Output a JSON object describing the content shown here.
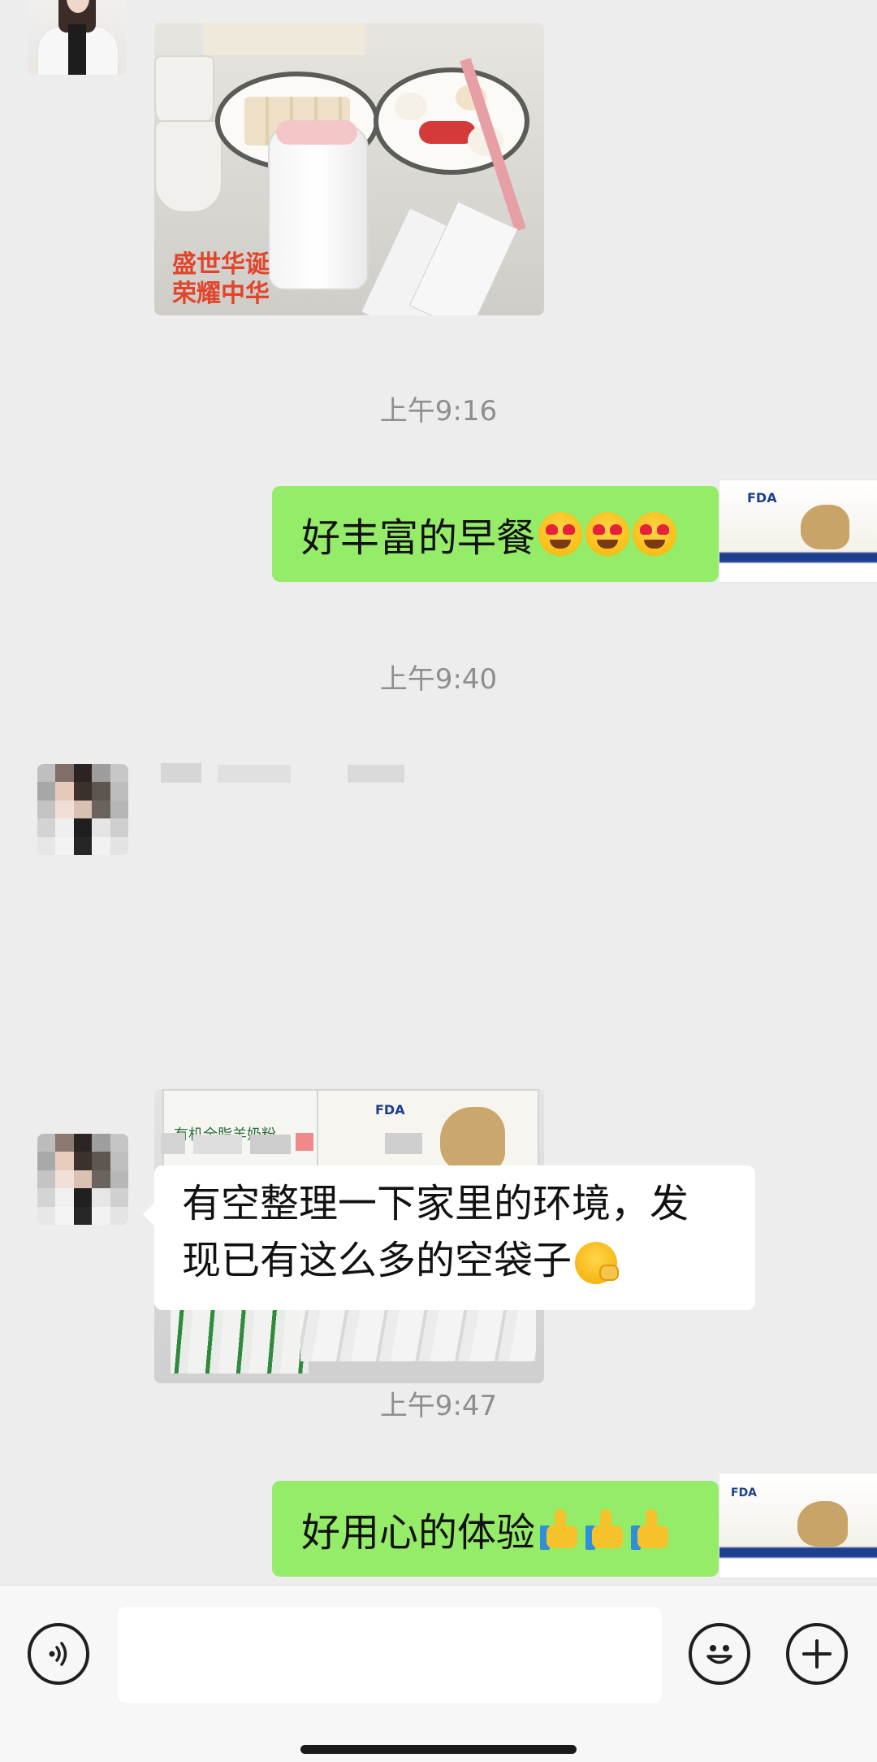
{
  "messages": [
    {
      "type": "image",
      "sender": "other",
      "desc": "breakfast-photo",
      "caption_lines": [
        "盛世华诞",
        "荣耀中华"
      ]
    },
    {
      "type": "timestamp",
      "text": "上午9:16"
    },
    {
      "type": "text",
      "sender": "self",
      "text": "好丰富的早餐"
    },
    {
      "type": "timestamp",
      "text": "上午9:40"
    },
    {
      "type": "image",
      "sender": "other",
      "desc": "milk-powder-packets-photo",
      "box_text": [
        "有机全脂羊奶粉",
        "FDA"
      ]
    },
    {
      "type": "text",
      "sender": "other",
      "text_line1": "有空整理一下家里的环境，发",
      "text_line2": "现已有这么多的空袋子"
    },
    {
      "type": "timestamp",
      "text": "上午9:47"
    },
    {
      "type": "text",
      "sender": "self",
      "text": "好用心的体验"
    }
  ],
  "product": {
    "badge": "FDA"
  },
  "input": {
    "placeholder": ""
  },
  "icons": {
    "voice": "voice-wave-icon",
    "emoji": "emoji-smile-icon",
    "plus": "plus-icon"
  },
  "colors": {
    "self_bubble": "#95ec69",
    "other_bubble": "#ffffff",
    "background": "#ededed"
  }
}
